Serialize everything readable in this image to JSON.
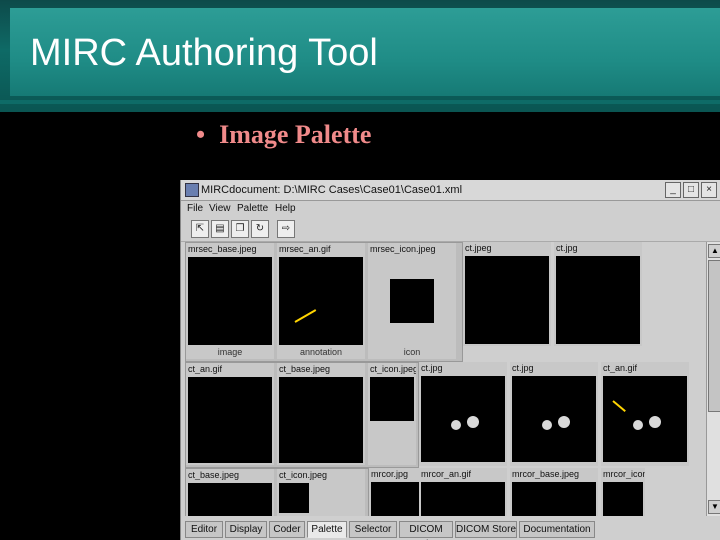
{
  "slide": {
    "title": "MIRC Authoring Tool",
    "bullet_marker": "•",
    "bullet_text": "Image Palette"
  },
  "window": {
    "title": "MIRCdocument: D:\\MIRC Cases\\Case01\\Case01.xml",
    "controls": [
      "_",
      "□",
      "×"
    ]
  },
  "menu": [
    "File",
    "View",
    "Palette",
    "Help"
  ],
  "toolbar_icons": [
    "open-icon",
    "save-icon",
    "copy-icon",
    "refresh-icon",
    "export-icon"
  ],
  "groups": [
    {
      "cells": [
        {
          "name": "mrsec_base.jpeg",
          "caption": "image",
          "kind": "xray-dark"
        },
        {
          "name": "mrsec_an.gif",
          "caption": "annotation",
          "kind": "xray-dark"
        },
        {
          "name": "mrsec_icon.jpeg",
          "caption": "icon",
          "kind": "xray-dark"
        }
      ]
    },
    {
      "cells": [
        {
          "name": "ct_an.gif",
          "kind": "xray"
        },
        {
          "name": "ct_base.jpeg",
          "kind": "xray"
        },
        {
          "name": "ct_icon.jpeg",
          "kind": "xray"
        }
      ]
    },
    {
      "cells": [
        {
          "name": "ct_base.jpeg",
          "kind": "mri"
        },
        {
          "name": "ct_icon.jpeg",
          "kind": "mri"
        }
      ]
    }
  ],
  "loose_cells": [
    {
      "name": "ct.jpeg",
      "kind": "xray"
    },
    {
      "name": "ct.jpg",
      "kind": "xray"
    },
    {
      "name": "ct.jpg",
      "kind": "ct"
    },
    {
      "name": "ct.jpg",
      "kind": "ct"
    },
    {
      "name": "ct_an.gif",
      "kind": "ct"
    },
    {
      "name": "mrcor.jpg",
      "kind": "mri"
    },
    {
      "name": "mrcor_an.gif",
      "kind": "mri"
    },
    {
      "name": "mrcor_base.jpeg",
      "kind": "mri"
    },
    {
      "name": "mrcor_icon.jp",
      "kind": "mri"
    }
  ],
  "tabs": [
    {
      "label": "Editor",
      "active": false
    },
    {
      "label": "Display",
      "active": false
    },
    {
      "label": "Coder",
      "active": false
    },
    {
      "label": "Palette",
      "active": true
    },
    {
      "label": "Selector",
      "active": false
    },
    {
      "label": "DICOM Q/R",
      "active": false
    },
    {
      "label": "DICOM Store",
      "active": false
    },
    {
      "label": "Documentation",
      "active": false
    }
  ],
  "colors": {
    "bullet": "#f08a8a",
    "annotation_arrow": "#ffd400",
    "banner": "#1f8c86"
  }
}
